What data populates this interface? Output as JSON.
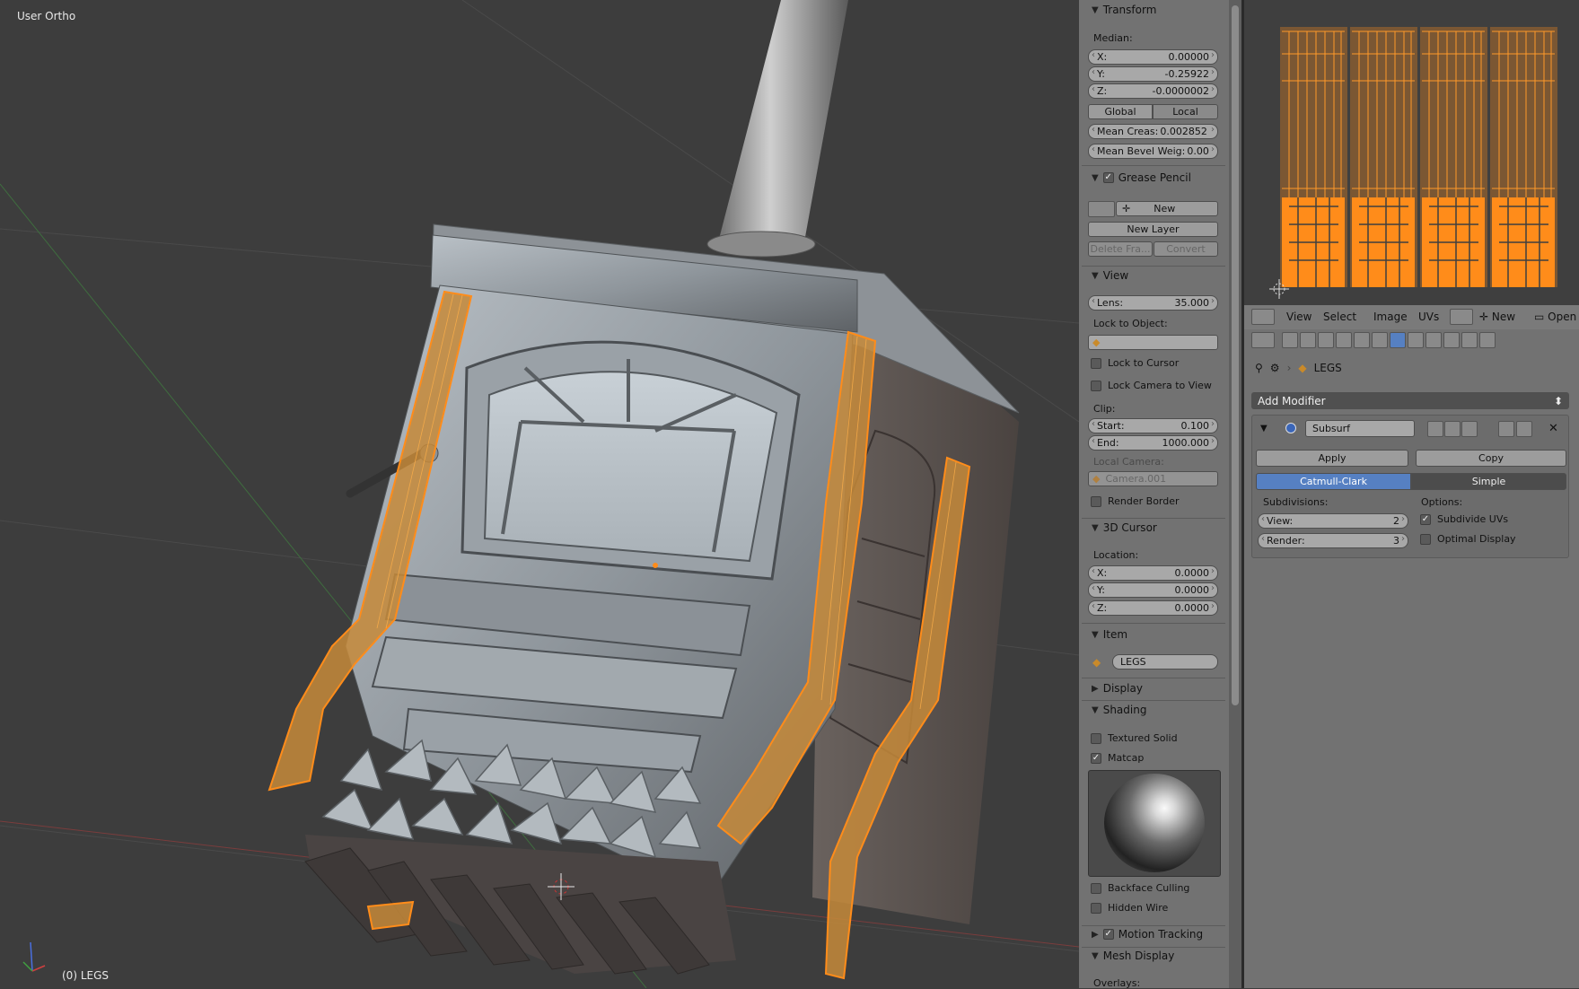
{
  "viewport": {
    "view_name": "User Ortho",
    "object_label": "(0) LEGS"
  },
  "npanel": {
    "transform": {
      "header": "Transform",
      "median_label": "Median:",
      "x_label": "X:",
      "x_value": "0.00000",
      "y_label": "Y:",
      "y_value": "-0.25922",
      "z_label": "Z:",
      "z_value": "-0.0000002",
      "global_label": "Global",
      "local_label": "Local",
      "mean_crease_label": "Mean Creas:",
      "mean_crease_value": "0.002852",
      "mean_bevel_label": "Mean Bevel Weig:",
      "mean_bevel_value": "0.00"
    },
    "grease_pencil": {
      "header": "Grease Pencil",
      "new_label": "New",
      "new_layer_label": "New Layer",
      "delete_frame_label": "Delete Fra...",
      "convert_label": "Convert"
    },
    "view": {
      "header": "View",
      "lens_label": "Lens:",
      "lens_value": "35.000",
      "lock_to_object_label": "Lock to Object:",
      "lock_to_cursor_label": "Lock to Cursor",
      "lock_camera_label": "Lock Camera to View",
      "clip_label": "Clip:",
      "start_label": "Start:",
      "start_value": "0.100",
      "end_label": "End:",
      "end_value": "1000.000",
      "local_camera_label": "Local Camera:",
      "local_camera_value": "Camera.001",
      "render_border_label": "Render Border"
    },
    "cursor": {
      "header": "3D Cursor",
      "location_label": "Location:",
      "x_label": "X:",
      "x_value": "0.0000",
      "y_label": "Y:",
      "y_value": "0.0000",
      "z_label": "Z:",
      "z_value": "0.0000"
    },
    "item": {
      "header": "Item",
      "name": "LEGS"
    },
    "display": {
      "header": "Display"
    },
    "shading": {
      "header": "Shading",
      "textured_solid_label": "Textured Solid",
      "matcap_label": "Matcap",
      "backface_culling_label": "Backface Culling",
      "hidden_wire_label": "Hidden Wire"
    },
    "motion_tracking": {
      "header": "Motion Tracking"
    },
    "mesh_display": {
      "header": "Mesh Display",
      "overlays_label": "Overlays:"
    }
  },
  "uv_header": {
    "menus": [
      "View",
      "Select",
      "Image",
      "UVs"
    ],
    "new_label": "New",
    "open_label": "Open"
  },
  "properties": {
    "object_name": "LEGS",
    "add_modifier_label": "Add Modifier",
    "modifier_name": "Subsurf",
    "apply_label": "Apply",
    "copy_label": "Copy",
    "catmull_clark_label": "Catmull-Clark",
    "simple_label": "Simple",
    "subdivisions_label": "Subdivisions:",
    "view_label": "View:",
    "view_value": "2",
    "render_label": "Render:",
    "render_value": "3",
    "options_label": "Options:",
    "subdivide_uvs_label": "Subdivide UVs",
    "optimal_display_label": "Optimal Display"
  },
  "colors": {
    "selection_orange": "#ff8c1a",
    "active_blue": "#5680c2",
    "panel_grey": "#727272",
    "viewport_grey": "#3d3d3d"
  }
}
